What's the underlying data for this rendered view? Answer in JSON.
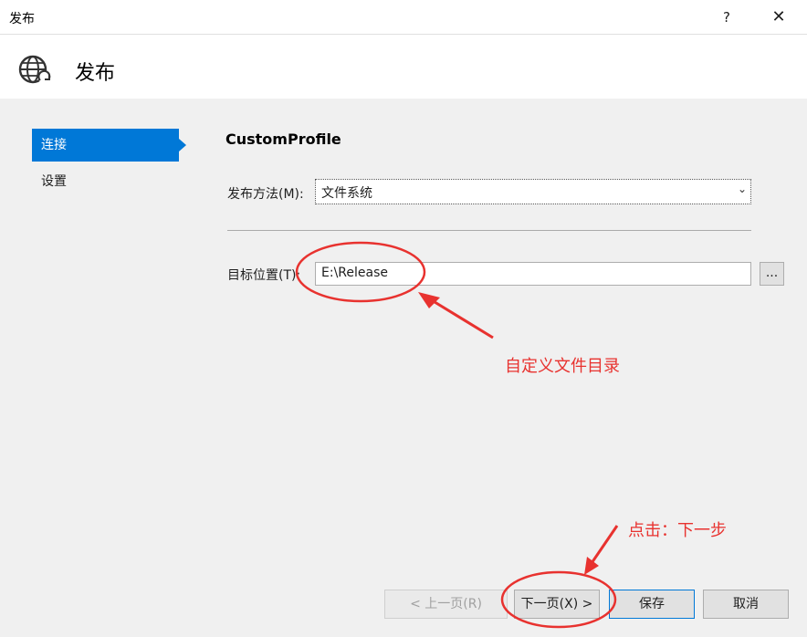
{
  "window": {
    "title": "发布",
    "help_label": "?",
    "close_label": "✕"
  },
  "header": {
    "title": "发布",
    "icon": "globe-publish-icon"
  },
  "sidebar": {
    "items": [
      {
        "label": "连接",
        "active": true
      },
      {
        "label": "设置",
        "active": false
      }
    ]
  },
  "main": {
    "profile_name": "CustomProfile",
    "publish_method": {
      "label": "发布方法(M):",
      "value": "文件系统"
    },
    "target_location": {
      "label": "目标位置(T):",
      "value": "E:\\Release",
      "browse_label": "..."
    }
  },
  "footer": {
    "prev_label": "< 上一页(R)",
    "next_label": "下一页(X) >",
    "save_label": "保存",
    "cancel_label": "取消"
  },
  "annotations": {
    "custom_dir": "自定义文件目录",
    "click_next": "点击：下一步",
    "color": "#e8322f"
  },
  "colors": {
    "accent": "#0078d7"
  }
}
